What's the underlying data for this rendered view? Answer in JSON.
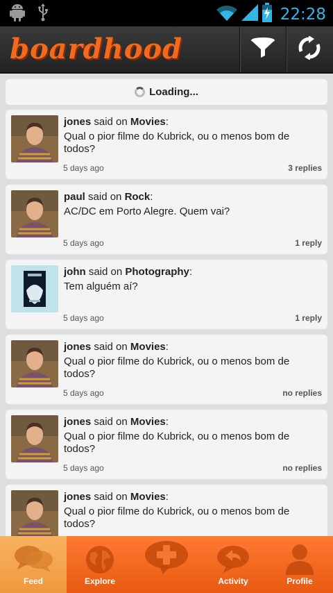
{
  "status_bar": {
    "time": "22:28"
  },
  "app_bar": {
    "logo": "boardhood"
  },
  "feed": {
    "loading_text": "Loading...",
    "posts": [
      {
        "user": "jones",
        "said_on": "said on",
        "board": "Movies",
        "colon": ":",
        "message": "Qual o pior filme do Kubrick, ou o menos bom de todos?",
        "time": "5 days ago",
        "replies": "3 replies"
      },
      {
        "user": "paul",
        "said_on": "said on",
        "board": "Rock",
        "colon": ":",
        "message": "AC/DC em Porto Alegre. Quem vai?",
        "time": "5 days ago",
        "replies": "1 reply"
      },
      {
        "user": "john",
        "said_on": "said on",
        "board": "Photography",
        "colon": ":",
        "message": "Tem alguém aí?",
        "time": "5 days ago",
        "replies": "1 reply"
      },
      {
        "user": "jones",
        "said_on": "said on",
        "board": "Movies",
        "colon": ":",
        "message": "Qual o pior filme do Kubrick, ou o menos bom de todos?",
        "time": "5 days ago",
        "replies": "no replies"
      },
      {
        "user": "jones",
        "said_on": "said on",
        "board": "Movies",
        "colon": ":",
        "message": "Qual o pior filme do Kubrick, ou o menos bom de todos?",
        "time": "5 days ago",
        "replies": "no replies"
      },
      {
        "user": "jones",
        "said_on": "said on",
        "board": "Movies",
        "colon": ":",
        "message": "Qual o pior filme do Kubrick, ou o menos bom de todos?",
        "time": "",
        "replies": ""
      }
    ]
  },
  "bottom_nav": [
    {
      "label": "Feed",
      "icon": "chat-bubbles-icon",
      "active": true
    },
    {
      "label": "Explore",
      "icon": "globe-icon",
      "active": false
    },
    {
      "label": "",
      "icon": "add-post-icon",
      "active": false
    },
    {
      "label": "Activity",
      "icon": "reply-bubble-icon",
      "active": false
    },
    {
      "label": "Profile",
      "icon": "person-icon",
      "active": false
    }
  ],
  "colors": {
    "accent": "#f26522",
    "nav_active": "#f5a24a",
    "clock": "#33b5e5",
    "card": "#f4f4f4",
    "background": "#dedede"
  }
}
